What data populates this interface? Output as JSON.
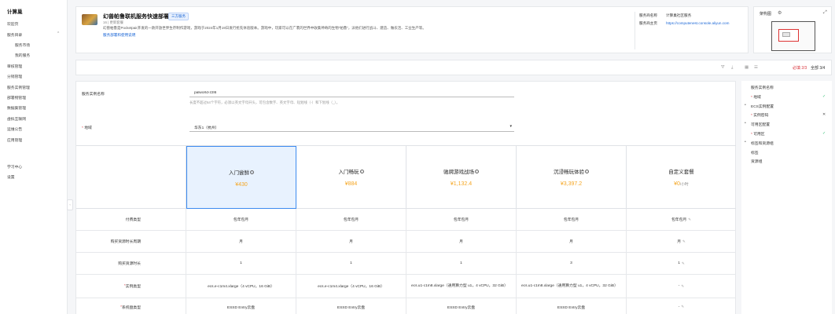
{
  "sidebar": {
    "title": "计算巢",
    "items": [
      {
        "label": "欢迎页"
      },
      {
        "label": "服务目录"
      },
      {
        "label": "服务市场"
      },
      {
        "label": "我的服务"
      },
      {
        "label": "审核管理"
      },
      {
        "label": "分销管理"
      },
      {
        "label": "服务实例管理"
      },
      {
        "label": "部署物管理"
      },
      {
        "label": "数据集管理"
      },
      {
        "label": "虚拟互联网"
      },
      {
        "label": "运维公告"
      },
      {
        "label": "应用管理"
      },
      {
        "label": "学习中心"
      },
      {
        "label": "设置"
      }
    ]
  },
  "service": {
    "title": "幻兽帕鲁联机服务快速部署",
    "badge": "三方服务",
    "meta": "16 | 更新套餐",
    "description": "幻兽帕鲁是Pocketpair开发的一款开放世界生存制作游戏，游戏于2024年1月19日发行抢先体验版本。游戏中，玩家可以在广袤的世界中收集神奇的生物“帕鲁”，派他们进行战斗、建造、做农活、工业生产等。",
    "deploy_link": "服务部署和使用说明",
    "provider_name_label": "服务商名称",
    "provider_name": "计算巢社区服务",
    "provider_home_label": "服务商主页",
    "provider_home": "https://computenest.console.aliyun.com"
  },
  "architecture": {
    "title": "架构图"
  },
  "toolbar": {
    "required_progress": "必填 2/3",
    "all_progress": "全部 3/4"
  },
  "form": {
    "instance_name_label": "服务实例名称",
    "instance_name_value": "palworld-z2l6",
    "instance_name_hint": "长度不超过64个字符，必须以英文字母开头，可包含数字、英文字母、短划线（-）和下划线（_）。",
    "region_label": "地域",
    "region_value": "华东1（杭州）"
  },
  "plans": [
    {
      "name": "入门尝鲜",
      "price": "¥430",
      "unit": ""
    },
    {
      "name": "入门畅玩",
      "price": "¥884",
      "unit": ""
    },
    {
      "name": "驰骋游戏战场",
      "price": "¥1,132.4",
      "unit": ""
    },
    {
      "name": "沉浸畅玩体验",
      "price": "¥3,397.2",
      "unit": ""
    },
    {
      "name": "自定义套餐",
      "price": "¥0",
      "unit": "/小时"
    }
  ],
  "rows": [
    {
      "label": "付费类型",
      "required": false,
      "values": [
        "包年包月",
        "包年包月",
        "包年包月",
        "包年包月",
        "包年包月"
      ]
    },
    {
      "label": "购买资源时长周期",
      "required": false,
      "values": [
        "月",
        "月",
        "月",
        "月",
        "月"
      ]
    },
    {
      "label": "购买资源时长",
      "required": false,
      "values": [
        "1",
        "1",
        "1",
        "3",
        "1"
      ]
    },
    {
      "label": "实例类型",
      "required": true,
      "values": [
        "ecs.e-c1m4.xlarge（4 vCPU，16 GiB）",
        "ecs.e-c1m4.xlarge（4 vCPU，16 GiB）",
        "ecs.u1-c1m8.xlarge（通用算力型 u1，4 vCPU，32 GiB）",
        "ecs.u1-c1m8.xlarge（通用算力型 u1，4 vCPU，32 GiB）",
        "-"
      ]
    },
    {
      "label": "系统盘类型",
      "required": true,
      "values": [
        "ESSD Entry云盘",
        "ESSD Entry云盘",
        "ESSD Entry云盘",
        "ESSD Entry云盘",
        "-"
      ]
    }
  ],
  "nav": {
    "items": [
      {
        "label": "服务实例名称",
        "required": false,
        "status": ""
      },
      {
        "label": "地域",
        "required": true,
        "status": "ok"
      },
      {
        "label": "ECS实例配置",
        "required": false,
        "status": ""
      },
      {
        "label": "实例密码",
        "required": true,
        "status": "error"
      },
      {
        "label": "可用区配置",
        "required": false,
        "status": ""
      },
      {
        "label": "可用区",
        "required": true,
        "status": "ok"
      },
      {
        "label": "标签和资源组",
        "required": false,
        "status": ""
      },
      {
        "label": "标签",
        "required": false,
        "status": ""
      },
      {
        "label": "资源组",
        "required": false,
        "status": ""
      }
    ]
  },
  "colors": {
    "accent": "#1a66d6",
    "price": "#f5a623",
    "required": "#d9363e",
    "ok": "#2fbf71",
    "selected_bg": "#e8f2fe"
  }
}
